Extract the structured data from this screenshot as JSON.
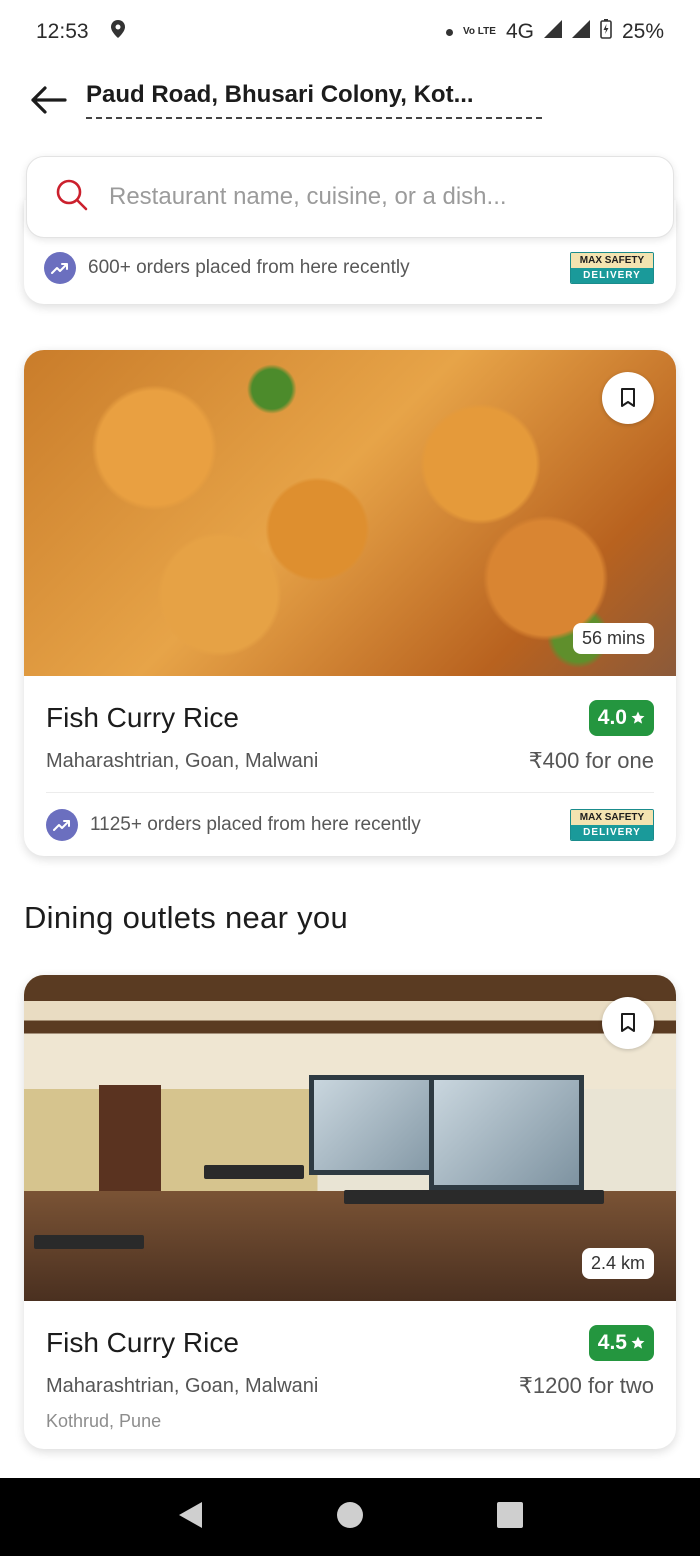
{
  "status_bar": {
    "time": "12:53",
    "network": "4G",
    "volte": "Vo\nLTE",
    "battery": "25%"
  },
  "header": {
    "location": "Paud Road, Bhusari Colony, Kot..."
  },
  "search": {
    "placeholder": "Restaurant name, cuisine, or a dish..."
  },
  "top_card": {
    "orders_text": "600+ orders placed from here recently",
    "badge_top": "MAX SAFETY",
    "badge_bottom": "DELIVERY"
  },
  "card1": {
    "name": "Fish Curry Rice",
    "cuisines": "Maharashtrian, Goan, Malwani",
    "rating": "4.0",
    "price": "₹400 for one",
    "time_chip": "56 mins",
    "orders_text": "1125+ orders placed from here recently",
    "badge_top": "MAX SAFETY",
    "badge_bottom": "DELIVERY"
  },
  "section": {
    "title": "Dining outlets near you"
  },
  "card2": {
    "name": "Fish Curry Rice",
    "cuisines": "Maharashtrian, Goan, Malwani",
    "rating": "4.5",
    "price": "₹1200 for two",
    "distance_chip": "2.4 km",
    "locality": "Kothrud, Pune"
  },
  "colors": {
    "rating_green": "#24963f",
    "accent_red": "#cb202d",
    "trend_purple": "#6b6fbf"
  }
}
